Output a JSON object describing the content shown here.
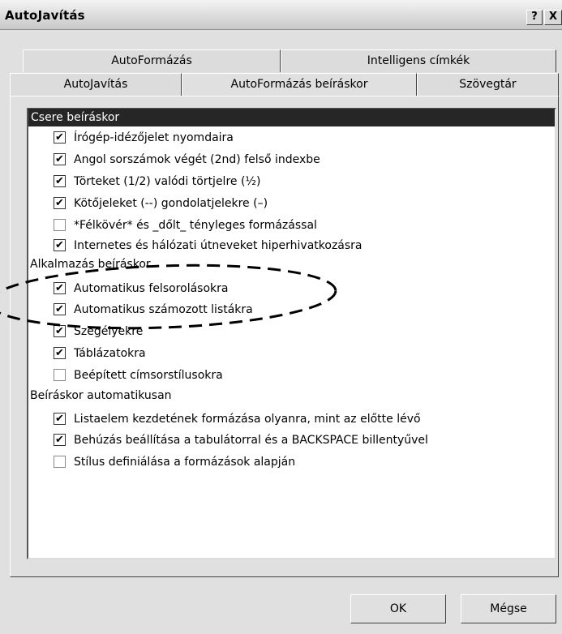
{
  "window": {
    "title": "AutoJavítás",
    "help_glyph": "?",
    "close_glyph": "X"
  },
  "tabs": {
    "row1": [
      "AutoFormázás",
      "Intelligens címkék"
    ],
    "row2": [
      "AutoJavítás",
      "AutoFormázás beíráskor",
      "Szövegtár"
    ],
    "active": "AutoFormázás beíráskor"
  },
  "groups": [
    {
      "title": "Csere beíráskor",
      "options": [
        {
          "label": "Írógép-idézőjelet nyomdaira",
          "checked": true
        },
        {
          "label": "Angol sorszámok végét (2nd) felső indexbe",
          "checked": true
        },
        {
          "label": "Törteket (1/2) valódi törtjelre (½)",
          "checked": true
        },
        {
          "label": "Kötőjeleket (--) gondolatjelekre (–)",
          "checked": true
        },
        {
          "label": "*Félkövér* és _dőlt_ tényleges formázással",
          "checked": false
        },
        {
          "label": "Internetes és hálózati útneveket hiperhivatkozásra",
          "checked": true
        }
      ]
    },
    {
      "title": "Alkalmazás beíráskor",
      "options": [
        {
          "label": "Automatikus felsorolásokra",
          "checked": true
        },
        {
          "label": "Automatikus számozott listákra",
          "checked": true
        },
        {
          "label": "Szegélyekre",
          "checked": true
        },
        {
          "label": "Táblázatokra",
          "checked": true
        },
        {
          "label": "Beépített címsorstílusokra",
          "checked": false
        }
      ]
    },
    {
      "title": "Beíráskor automatikusan",
      "options": [
        {
          "label": "Listaelem kezdetének formázása olyanra, mint az előtte lévő",
          "checked": true
        },
        {
          "label": "Behúzás beállítása a tabulátorral és a BACKSPACE billentyűvel",
          "checked": true
        },
        {
          "label": "Stílus definiálása a formázások alapján",
          "checked": false
        }
      ]
    }
  ],
  "buttons": {
    "ok": "OK",
    "cancel": "Mégse"
  },
  "check_glyph": "✔"
}
